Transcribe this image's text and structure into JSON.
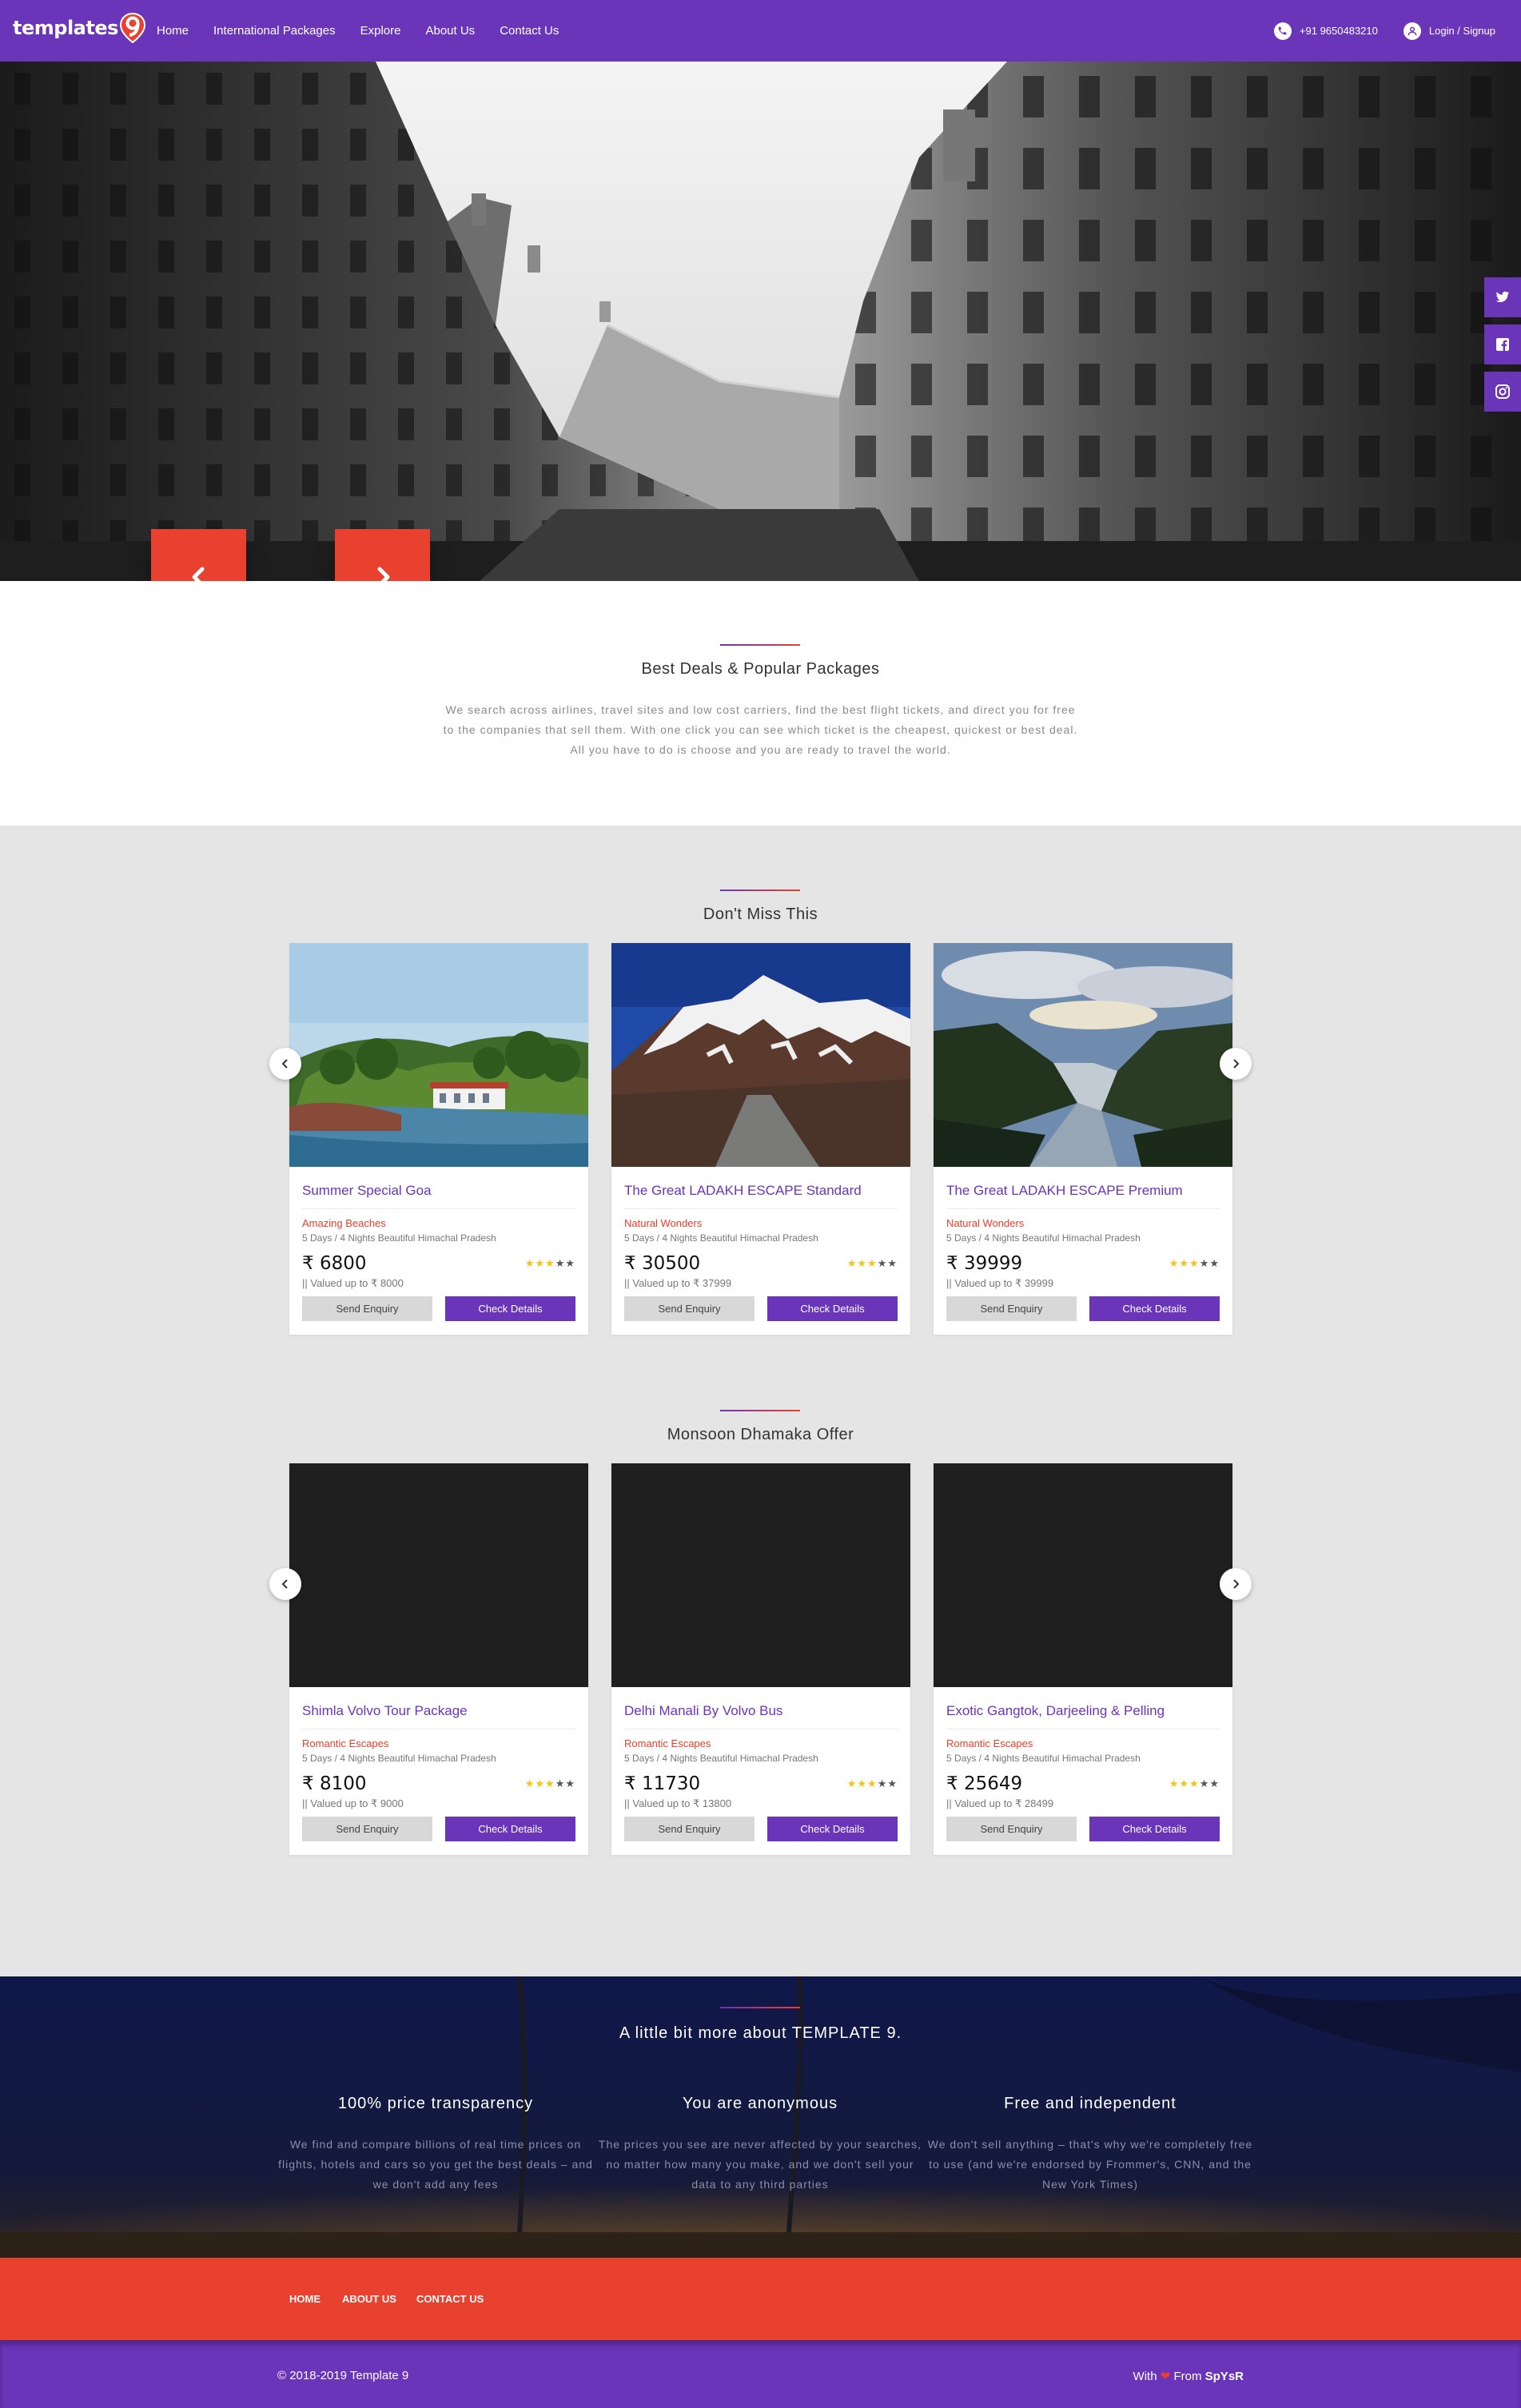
{
  "nav": {
    "brand": "templates",
    "links": [
      "Home",
      "International Packages",
      "Explore",
      "About Us",
      "Contact Us"
    ],
    "phone": "+91 9650483210",
    "login": "Login / Signup"
  },
  "hero": {
    "prev_icon": "chevron-left-icon",
    "next_icon": "chevron-right-icon",
    "social": [
      "twitter-icon",
      "facebook-icon",
      "instagram-icon"
    ]
  },
  "intro": {
    "title": "Best Deals & Popular Packages",
    "text": "We search across airlines, travel sites and low cost carriers, find the best flight tickets, and direct you for free to the companies that sell them. With one click you can see which ticket is the cheapest, quickest or best deal. All you have to do is choose and you are ready to travel the world."
  },
  "dont_miss": {
    "title": "Don't Miss This",
    "cards": [
      {
        "title": "Summer Special Goa",
        "category": "Amazing Beaches",
        "duration": "5 Days / 4 Nights Beautiful Himachal Pradesh",
        "price": "6800",
        "valued": "|| Valued up to ₹ 8000",
        "rating": 3
      },
      {
        "title": "The Great LADAKH ESCAPE Standard",
        "category": "Natural Wonders",
        "duration": "5 Days / 4 Nights Beautiful Himachal Pradesh",
        "price": "30500",
        "valued": "|| Valued up to ₹ 37999",
        "rating": 3
      },
      {
        "title": "The Great LADAKH ESCAPE Premium",
        "category": "Natural Wonders",
        "duration": "5 Days / 4 Nights Beautiful Himachal Pradesh",
        "price": "39999",
        "valued": "|| Valued up to ₹ 39999",
        "rating": 3
      }
    ]
  },
  "monsoon": {
    "title": "Monsoon Dhamaka Offer",
    "cards": [
      {
        "title": "Shimla Volvo Tour Package",
        "category": "Romantic Escapes",
        "duration": "5 Days / 4 Nights Beautiful Himachal Pradesh",
        "price": "8100",
        "valued": "|| Valued up to ₹ 9000",
        "rating": 3
      },
      {
        "title": "Delhi Manali By Volvo Bus",
        "category": "Romantic Escapes",
        "duration": "5 Days / 4 Nights Beautiful Himachal Pradesh",
        "price": "11730",
        "valued": "|| Valued up to ₹ 13800",
        "rating": 3
      },
      {
        "title": "Exotic Gangtok, Darjeeling & Pelling",
        "category": "Romantic Escapes",
        "duration": "5 Days / 4 Nights Beautiful Himachal Pradesh",
        "price": "25649",
        "valued": "|| Valued up to ₹ 28499",
        "rating": 3
      }
    ]
  },
  "buttons": {
    "enquiry": "Send Enquiry",
    "details": "Check Details",
    "currency": "₹"
  },
  "about": {
    "title": "A little bit more about TEMPLATE 9.",
    "features": [
      {
        "title": "100% price transparency",
        "text": "We find and compare billions of real time prices on flights, hotels and cars so you get the best deals – and we don't add any fees"
      },
      {
        "title": "You are anonymous",
        "text": "The prices you see are never affected by your searches, no matter how many you make, and we don't sell your data to any third parties"
      },
      {
        "title": "Free and independent",
        "text": "We don't sell anything – that's why we're completely free to use (and we're endorsed by Frommer's, CNN, and the New York Times)"
      }
    ]
  },
  "footer": {
    "links": [
      "HOME",
      "ABOUT US",
      "CONTACT US"
    ],
    "copyright": "© 2018-2019 Template 9",
    "credit_prefix": "With",
    "credit_middle": "From",
    "credit_name": "SpYsR"
  },
  "colors": {
    "primary": "#6a35b9",
    "accent": "#e8412f",
    "star": "#f0c419"
  }
}
